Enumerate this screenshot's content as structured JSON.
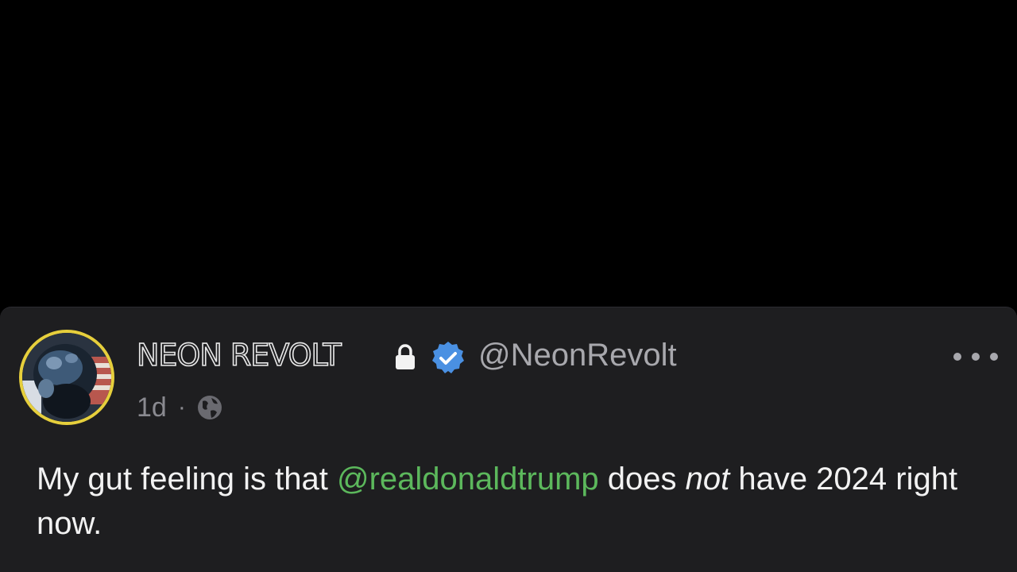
{
  "post": {
    "author_name": "NEON REVOLT",
    "handle": "@NeonRevolt",
    "age": "1d",
    "separator": "·",
    "visibility_icon": "globe-icon",
    "locked_icon": "lock-icon",
    "verified_icon": "verified-badge-icon",
    "more_icon": "more-options-icon",
    "body": {
      "part1": "My gut feeling is that ",
      "mention": "@realdonaldtrump",
      "part2": " does ",
      "emphasis": "not",
      "part3": " have 2024 right now."
    }
  },
  "colors": {
    "background": "#000000",
    "card": "#1e1e20",
    "mention": "#5cb85c",
    "verified": "#4a90e2",
    "avatar_ring": "#e6cf3c",
    "muted_text": "#8a8a90"
  }
}
